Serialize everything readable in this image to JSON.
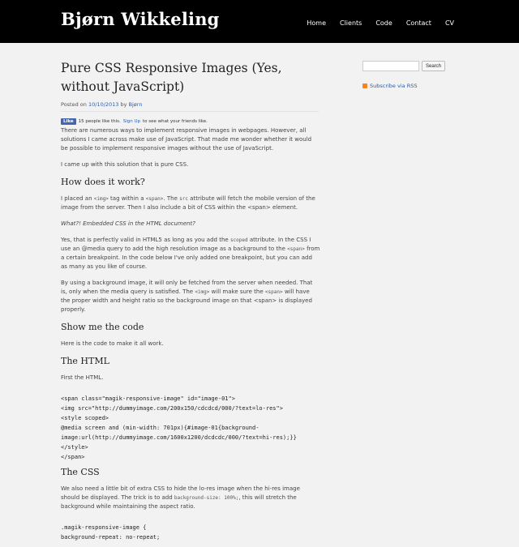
{
  "header": {
    "site_title": "Bjørn Wikkeling",
    "nav": [
      "Home",
      "Clients",
      "Code",
      "Contact",
      "CV"
    ]
  },
  "sidebar": {
    "search_placeholder": "",
    "search_button": "Search",
    "rss_label": "Subscribe via RSS"
  },
  "post": {
    "title": "Pure CSS Responsive Images (Yes, without JavaScript)",
    "meta_prefix": "Posted on ",
    "date": "10/10/2013",
    "meta_by": " by ",
    "author": "Bjørn",
    "fb_like": "Like",
    "fb_count_text": "15 people like this.",
    "fb_signup": "Sign Up",
    "fb_suffix": "to see what your friends like.",
    "intro": "There are numerous ways to implement responsive images in webpages. However, all solutions I came across make use of JavaScript. That made me wonder whether it would be possible to implement responsive images without the use of JavaScript.",
    "intro2": "I came up with this solution that is pure CSS.",
    "h_how": "How does it work?",
    "p_how_1a": "I placed an ",
    "p_how_1_img": "<img>",
    "p_how_1b": " tag within a ",
    "p_how_1_span": "<span>",
    "p_how_1c": ". The ",
    "p_how_1_src": "src",
    "p_how_1d": " attribute will fetch the mobile version of the image from the server. Then I also include a bit of CSS within the <span> element.",
    "p_ital": "What?! Embedded CSS in the HTML document?",
    "p_valid_a": "Yes, that is perfectly valid in HTML5 as long as you add the ",
    "p_valid_scoped": "scoped",
    "p_valid_b": " attribute. In the CSS I use an @media query to add the high resolution image as a background to the ",
    "p_valid_span": "<span>",
    "p_valid_c": " from a certain breakpoint. In the code below I've only added one breakpoint, but you can add as many as you like of course.",
    "p_bg_a": "By using a background image, it will only be fetched from the server when needed. That is, only when the media query is satisfied. The ",
    "p_bg_img": "<img>",
    "p_bg_b": " will make sure the ",
    "p_bg_span": "<span>",
    "p_bg_c": " will have the proper width and height ratio so the background image on that <span> is displayed properly.",
    "h_show": "Show me the code",
    "p_code": "Here is the code to make it all work.",
    "h_html": "The HTML",
    "p_first": "First the HTML.",
    "code_html": "<span class=\"magik-responsive-image\" id=\"image-01\">\n<img src=\"http://dummyimage.com/200x150/cdcdcd/000/?text=lo-res\">\n<style scoped>\n@media screen and (min-width: 701px){#image-01{background-\nimage:url(http://dummyimage.com/1600x1200/dcdcdc/000/?text=hi-res);}}\n</style>\n</span>",
    "h_css": "The CSS",
    "p_css_a": "We also need a little bit of extra CSS to hide the lo-res image when the hi-res image should be displayed. The trick is to add ",
    "p_css_code": "background-size: 100%;",
    "p_css_b": ", this will stretch the background while maintaining the aspect ratio.",
    "code_css": ".magik-responsive-image {\nbackground-repeat: no-repeat;"
  }
}
